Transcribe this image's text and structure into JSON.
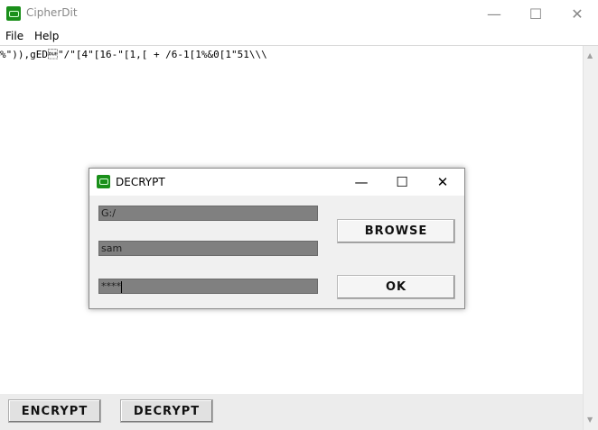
{
  "window": {
    "title": "CipherDit",
    "minimize_glyph": "—",
    "maximize_glyph": "☐",
    "close_glyph": "✕"
  },
  "menu": {
    "items": [
      {
        "label": "File"
      },
      {
        "label": "Help"
      }
    ]
  },
  "editor": {
    "content": "%\")),gED\u0010\"/\"[4\"[16-\"[1,[ + /6-1[1%&0[1\"51\\\\\\"
  },
  "bottom_bar": {
    "encrypt_label": "ENCRYPT",
    "decrypt_label": "DECRYPT"
  },
  "dialog": {
    "title": "DECRYPT",
    "path_value": "G:/",
    "name_value": "sam",
    "password_value": "****",
    "browse_label": "BROWSE",
    "ok_label": "OK"
  },
  "colors": {
    "app_icon": "#1a8f1a",
    "field_background": "#808080",
    "dialog_background": "#f0f0f0"
  }
}
